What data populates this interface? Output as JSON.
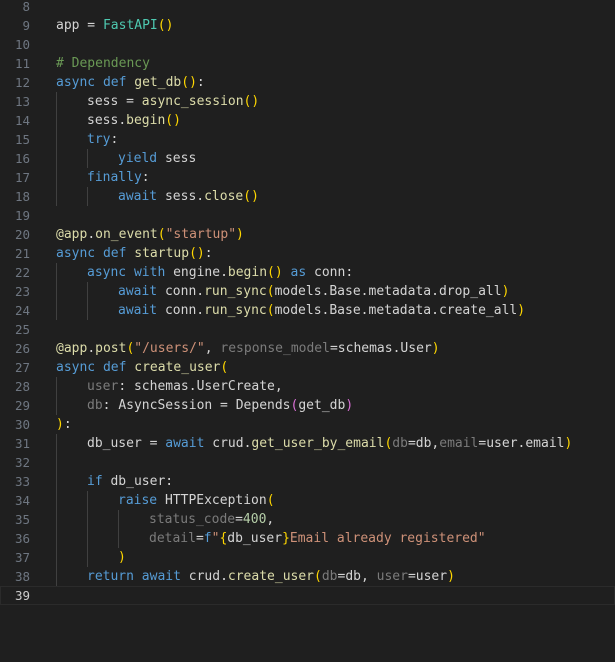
{
  "editor": {
    "language": "python",
    "current_line": 39,
    "lines": [
      {
        "n": "8",
        "indent": 0,
        "tokens": []
      },
      {
        "n": "9",
        "indent": 0,
        "tokens": [
          [
            "app",
            "plain"
          ],
          [
            " = ",
            "op"
          ],
          [
            "FastAPI",
            "cls"
          ],
          [
            "()",
            "br1"
          ]
        ]
      },
      {
        "n": "10",
        "indent": 0,
        "tokens": []
      },
      {
        "n": "11",
        "indent": 0,
        "tokens": [
          [
            "# Dependency",
            "com"
          ]
        ]
      },
      {
        "n": "12",
        "indent": 0,
        "tokens": [
          [
            "async",
            "kw"
          ],
          [
            " ",
            "plain"
          ],
          [
            "def",
            "kw"
          ],
          [
            " ",
            "plain"
          ],
          [
            "get_db",
            "fn"
          ],
          [
            "()",
            "br1"
          ],
          [
            ":",
            "plain"
          ]
        ]
      },
      {
        "n": "13",
        "indent": 1,
        "tokens": [
          [
            "sess",
            "plain"
          ],
          [
            " = ",
            "op"
          ],
          [
            "async_session",
            "fn"
          ],
          [
            "()",
            "br1"
          ]
        ]
      },
      {
        "n": "14",
        "indent": 1,
        "tokens": [
          [
            "sess",
            "plain"
          ],
          [
            ".",
            "plain"
          ],
          [
            "begin",
            "fn"
          ],
          [
            "()",
            "br1"
          ]
        ]
      },
      {
        "n": "15",
        "indent": 1,
        "tokens": [
          [
            "try",
            "kw"
          ],
          [
            ":",
            "plain"
          ]
        ]
      },
      {
        "n": "16",
        "indent": 2,
        "tokens": [
          [
            "yield",
            "kw"
          ],
          [
            " sess",
            "plain"
          ]
        ]
      },
      {
        "n": "17",
        "indent": 1,
        "tokens": [
          [
            "finally",
            "kw"
          ],
          [
            ":",
            "plain"
          ]
        ]
      },
      {
        "n": "18",
        "indent": 2,
        "tokens": [
          [
            "await",
            "kw"
          ],
          [
            " sess",
            "plain"
          ],
          [
            ".",
            "plain"
          ],
          [
            "close",
            "fn"
          ],
          [
            "()",
            "br1"
          ]
        ]
      },
      {
        "n": "19",
        "indent": 0,
        "tokens": []
      },
      {
        "n": "20",
        "indent": 0,
        "tokens": [
          [
            "@app",
            "dec"
          ],
          [
            ".",
            "plain"
          ],
          [
            "on_event",
            "fn"
          ],
          [
            "(",
            "br1"
          ],
          [
            "\"startup\"",
            "str"
          ],
          [
            ")",
            "br1"
          ]
        ]
      },
      {
        "n": "21",
        "indent": 0,
        "tokens": [
          [
            "async",
            "kw"
          ],
          [
            " ",
            "plain"
          ],
          [
            "def",
            "kw"
          ],
          [
            " ",
            "plain"
          ],
          [
            "startup",
            "fn"
          ],
          [
            "()",
            "br1"
          ],
          [
            ":",
            "plain"
          ]
        ]
      },
      {
        "n": "22",
        "indent": 1,
        "tokens": [
          [
            "async",
            "kw"
          ],
          [
            " ",
            "plain"
          ],
          [
            "with",
            "kw"
          ],
          [
            " engine",
            "plain"
          ],
          [
            ".",
            "plain"
          ],
          [
            "begin",
            "fn"
          ],
          [
            "()",
            "br1"
          ],
          [
            " ",
            "plain"
          ],
          [
            "as",
            "kw"
          ],
          [
            " conn:",
            "plain"
          ]
        ]
      },
      {
        "n": "23",
        "indent": 2,
        "tokens": [
          [
            "await",
            "kw"
          ],
          [
            " conn",
            "plain"
          ],
          [
            ".",
            "plain"
          ],
          [
            "run_sync",
            "fn"
          ],
          [
            "(",
            "br1"
          ],
          [
            "models",
            "plain"
          ],
          [
            ".",
            "plain"
          ],
          [
            "Base",
            "plain"
          ],
          [
            ".",
            "plain"
          ],
          [
            "metadata",
            "plain"
          ],
          [
            ".",
            "plain"
          ],
          [
            "drop_all",
            "plain"
          ],
          [
            ")",
            "br1"
          ]
        ]
      },
      {
        "n": "24",
        "indent": 2,
        "tokens": [
          [
            "await",
            "kw"
          ],
          [
            " conn",
            "plain"
          ],
          [
            ".",
            "plain"
          ],
          [
            "run_sync",
            "fn"
          ],
          [
            "(",
            "br1"
          ],
          [
            "models",
            "plain"
          ],
          [
            ".",
            "plain"
          ],
          [
            "Base",
            "plain"
          ],
          [
            ".",
            "plain"
          ],
          [
            "metadata",
            "plain"
          ],
          [
            ".",
            "plain"
          ],
          [
            "create_all",
            "plain"
          ],
          [
            ")",
            "br1"
          ]
        ]
      },
      {
        "n": "25",
        "indent": 0,
        "tokens": []
      },
      {
        "n": "26",
        "indent": 0,
        "tokens": [
          [
            "@app",
            "dec"
          ],
          [
            ".",
            "plain"
          ],
          [
            "post",
            "fn"
          ],
          [
            "(",
            "br1"
          ],
          [
            "\"/users/\"",
            "str"
          ],
          [
            ", ",
            "plain"
          ],
          [
            "response_model",
            "kwarg"
          ],
          [
            "=",
            "op"
          ],
          [
            "schemas",
            "plain"
          ],
          [
            ".",
            "plain"
          ],
          [
            "User",
            "plain"
          ],
          [
            ")",
            "br1"
          ]
        ]
      },
      {
        "n": "27",
        "indent": 0,
        "tokens": [
          [
            "async",
            "kw"
          ],
          [
            " ",
            "plain"
          ],
          [
            "def",
            "kw"
          ],
          [
            " ",
            "plain"
          ],
          [
            "create_user",
            "fn"
          ],
          [
            "(",
            "br1"
          ]
        ]
      },
      {
        "n": "28",
        "indent": 1,
        "tokens": [
          [
            "user",
            "kwarg"
          ],
          [
            ": ",
            "plain"
          ],
          [
            "schemas",
            "plain"
          ],
          [
            ".",
            "plain"
          ],
          [
            "UserCreate",
            "plain"
          ],
          [
            ",",
            "plain"
          ]
        ]
      },
      {
        "n": "29",
        "indent": 1,
        "tokens": [
          [
            "db",
            "kwarg"
          ],
          [
            ": ",
            "plain"
          ],
          [
            "AsyncSession",
            "plain"
          ],
          [
            " = ",
            "op"
          ],
          [
            "Depends",
            "plain"
          ],
          [
            "(",
            "br2"
          ],
          [
            "get_db",
            "plain"
          ],
          [
            ")",
            "br2"
          ]
        ]
      },
      {
        "n": "30",
        "indent": 0,
        "tokens": [
          [
            ")",
            "br1"
          ],
          [
            ":",
            "plain"
          ]
        ]
      },
      {
        "n": "31",
        "indent": 1,
        "tokens": [
          [
            "db_user",
            "plain"
          ],
          [
            " = ",
            "op"
          ],
          [
            "await",
            "kw"
          ],
          [
            " crud",
            "plain"
          ],
          [
            ".",
            "plain"
          ],
          [
            "get_user_by_email",
            "fn"
          ],
          [
            "(",
            "br1"
          ],
          [
            "db",
            "kwarg"
          ],
          [
            "=",
            "op"
          ],
          [
            "db",
            "plain"
          ],
          [
            ",",
            "plain"
          ],
          [
            "email",
            "kwarg"
          ],
          [
            "=",
            "op"
          ],
          [
            "user",
            "plain"
          ],
          [
            ".",
            "plain"
          ],
          [
            "email",
            "plain"
          ],
          [
            ")",
            "br1"
          ]
        ]
      },
      {
        "n": "32",
        "indent": 1,
        "tokens": []
      },
      {
        "n": "33",
        "indent": 1,
        "tokens": [
          [
            "if",
            "kw"
          ],
          [
            " db_user:",
            "plain"
          ]
        ]
      },
      {
        "n": "34",
        "indent": 2,
        "tokens": [
          [
            "raise",
            "kw"
          ],
          [
            " HTTPException",
            "plain"
          ],
          [
            "(",
            "br1"
          ]
        ]
      },
      {
        "n": "35",
        "indent": 3,
        "tokens": [
          [
            "status_code",
            "kwarg"
          ],
          [
            "=",
            "op"
          ],
          [
            "400",
            "num"
          ],
          [
            ",",
            "plain"
          ]
        ]
      },
      {
        "n": "36",
        "indent": 3,
        "tokens": [
          [
            "detail",
            "kwarg"
          ],
          [
            "=",
            "op"
          ],
          [
            "f",
            "fsp"
          ],
          [
            "\"",
            "str"
          ],
          [
            "{",
            "br1"
          ],
          [
            "db_user",
            "plain"
          ],
          [
            "}",
            "br1"
          ],
          [
            "Email already registered\"",
            "str"
          ]
        ]
      },
      {
        "n": "37",
        "indent": 2,
        "tokens": [
          [
            ")",
            "br1"
          ]
        ]
      },
      {
        "n": "38",
        "indent": 1,
        "tokens": [
          [
            "return",
            "kw"
          ],
          [
            " ",
            "plain"
          ],
          [
            "await",
            "kw"
          ],
          [
            " crud",
            "plain"
          ],
          [
            ".",
            "plain"
          ],
          [
            "create_user",
            "fn"
          ],
          [
            "(",
            "br1"
          ],
          [
            "db",
            "kwarg"
          ],
          [
            "=",
            "op"
          ],
          [
            "db",
            "plain"
          ],
          [
            ", ",
            "plain"
          ],
          [
            "user",
            "kwarg"
          ],
          [
            "=",
            "op"
          ],
          [
            "user",
            "plain"
          ],
          [
            ")",
            "br1"
          ]
        ]
      },
      {
        "n": "39",
        "indent": 0,
        "tokens": []
      }
    ]
  }
}
